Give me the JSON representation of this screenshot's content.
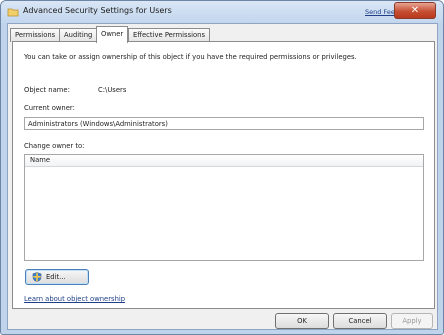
{
  "window": {
    "title": "Advanced Security Settings for Users",
    "feedback_link": "Send Feedback",
    "close_glyph": "✕"
  },
  "tabs": [
    {
      "label": "Permissions",
      "active": false
    },
    {
      "label": "Auditing",
      "active": false
    },
    {
      "label": "Owner",
      "active": true
    },
    {
      "label": "Effective Permissions",
      "active": false
    }
  ],
  "owner_tab": {
    "info": "You can take or assign ownership of this object if you have the required permissions or privileges.",
    "object_name_label": "Object name:",
    "object_name_value": "C:\\Users",
    "current_owner_label": "Current owner:",
    "current_owner_value": "Administrators (Windows\\Administrators)",
    "change_owner_label": "Change owner to:",
    "list_header": "Name",
    "edit_button": "Edit...",
    "learn_link": "Learn about object ownership"
  },
  "buttons": {
    "ok": "OK",
    "cancel": "Cancel",
    "apply": "Apply"
  },
  "colors": {
    "title_bar": "#c2d6ee",
    "close_button": "#c74f33",
    "link": "#1f3f88"
  },
  "icons": {
    "title": "folder-icon",
    "edit": "uac-shield-icon"
  }
}
